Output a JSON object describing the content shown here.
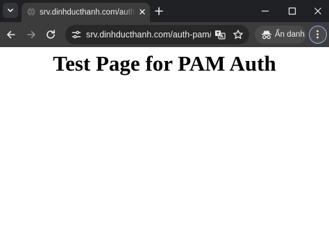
{
  "browser": {
    "tab": {
      "title": "srv.dinhducthanh.com/auth-pam/"
    },
    "address_bar": {
      "url": "srv.dinhducthanh.com/auth-pam/"
    },
    "profile": {
      "label": "Ẩn danh"
    },
    "icons": {
      "tab_search": "chevron-down-icon",
      "favicon": "globe-icon",
      "tab_close": "close-icon",
      "new_tab": "plus-icon",
      "minimize": "minimize-icon",
      "maximize": "maximize-icon",
      "close_window": "close-icon",
      "back": "arrow-left-icon",
      "forward": "arrow-right-icon",
      "reload": "reload-icon",
      "site_info": "tune-icon",
      "translate": "translate-icon",
      "bookmark": "star-icon",
      "incognito": "incognito-icon",
      "menu": "more-vert-icon"
    }
  },
  "page": {
    "heading": "Test Page for PAM Auth"
  },
  "colors": {
    "tabstrip_bg": "#202124",
    "toolbar_bg": "#3c3c3c",
    "omnibox_bg": "#282828",
    "text_light": "#e8eaed",
    "focus_ring": "#8ab4f8",
    "page_bg": "#ffffff",
    "heading_text": "#000000"
  }
}
